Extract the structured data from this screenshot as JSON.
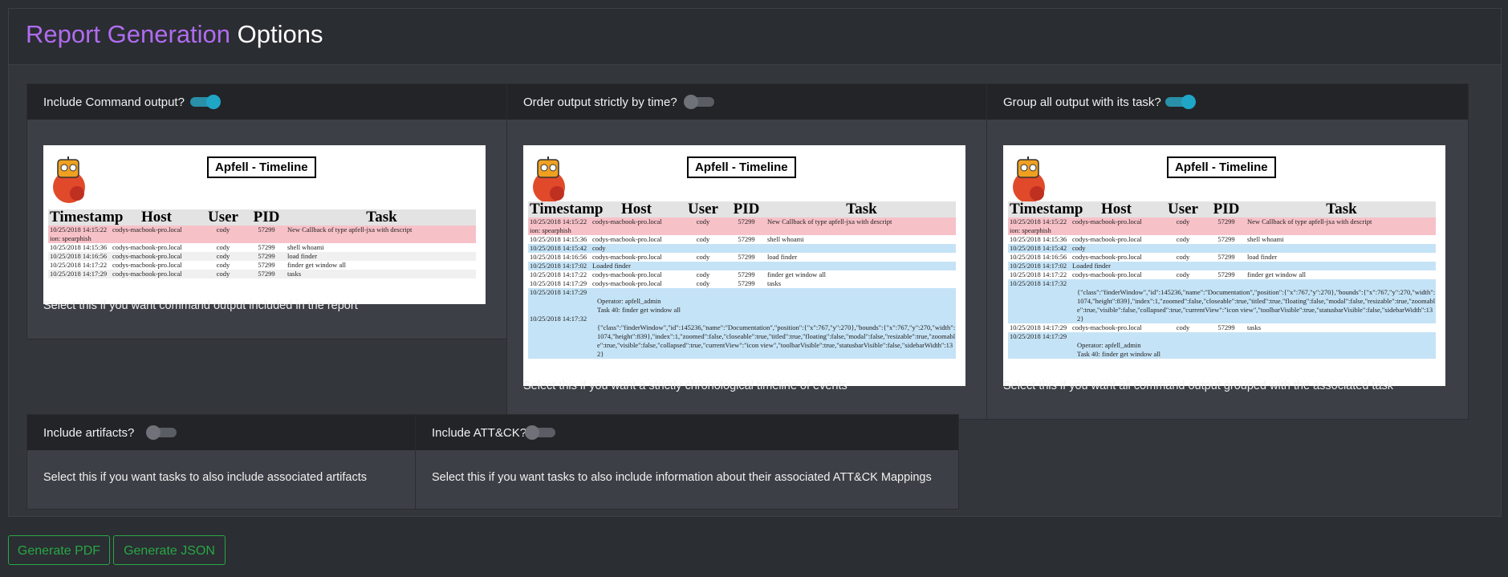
{
  "title": {
    "accent": "Report Generation",
    "rest": "Options"
  },
  "options": [
    {
      "label": "Include Command output?",
      "enabled": true,
      "description": "Select this if you want command output included in the report"
    },
    {
      "label": "Order output strictly by time?",
      "enabled": false,
      "description": "Select this if you want a strictly chronological timeline of events"
    },
    {
      "label": "Group all output with its task?",
      "enabled": true,
      "description": "Select this if you want all command output grouped with the associated task"
    },
    {
      "label": "Include artifacts?",
      "enabled": false,
      "description": "Select this if you want tasks to also include associated artifacts"
    },
    {
      "label": "Include ATT&CK?",
      "enabled": false,
      "description": "Select this if you want tasks to also include information about their associated ATT&CK Mappings"
    }
  ],
  "preview": {
    "title": "Apfell - Timeline",
    "headers": [
      "Timestamp",
      "Host",
      "User",
      "PID",
      "Task"
    ],
    "cmd_rows": [
      {
        "type": "red",
        "c": [
          "10/25/2018 14:15:22",
          "codys-macbook-pro.local",
          "cody",
          "57299",
          "New Callback of type apfell-jxa with descript"
        ],
        "extra": "ion: spearphish"
      },
      {
        "type": "plain",
        "c": [
          "10/25/2018 14:15:36",
          "codys-macbook-pro.local",
          "cody",
          "57299",
          "shell whoami"
        ]
      },
      {
        "type": "grey",
        "c": [
          "10/25/2018 14:16:56",
          "codys-macbook-pro.local",
          "cody",
          "57299",
          "load finder"
        ]
      },
      {
        "type": "plain",
        "c": [
          "10/25/2018 14:17:22",
          "codys-macbook-pro.local",
          "cody",
          "57299",
          "finder get window all"
        ]
      },
      {
        "type": "grey",
        "c": [
          "10/25/2018 14:17:29",
          "codys-macbook-pro.local",
          "cody",
          "57299",
          "tasks"
        ]
      }
    ],
    "time_rows": [
      {
        "type": "red",
        "c": [
          "10/25/2018 14:15:22",
          "codys-macbook-pro.local",
          "cody",
          "57299",
          "New Callback of type apfell-jxa with descript"
        ],
        "extra": "ion: spearphish"
      },
      {
        "type": "plain",
        "c": [
          "10/25/2018 14:15:36",
          "codys-macbook-pro.local",
          "cody",
          "57299",
          "shell whoami"
        ]
      },
      {
        "type": "blue",
        "c": [
          "10/25/2018 14:15:42",
          "cody",
          "",
          "",
          ""
        ]
      },
      {
        "type": "plain",
        "c": [
          "10/25/2018 14:16:56",
          "codys-macbook-pro.local",
          "cody",
          "57299",
          "load finder"
        ]
      },
      {
        "type": "blue",
        "c": [
          "10/25/2018 14:17:02",
          "Loaded finder",
          "",
          "",
          ""
        ]
      },
      {
        "type": "plain",
        "c": [
          "10/25/2018 14:17:22",
          "codys-macbook-pro.local",
          "cody",
          "57299",
          "finder get window all"
        ]
      },
      {
        "type": "plain",
        "c": [
          "10/25/2018 14:17:29",
          "codys-macbook-pro.local",
          "cody",
          "57299",
          "tasks"
        ]
      },
      {
        "type": "blue",
        "c": [
          "10/25/2018 14:17:29",
          "",
          "",
          "",
          ""
        ],
        "long": "Operator: apfell_admin\nTask 40: finder get window all"
      },
      {
        "type": "blue",
        "c": [
          "10/25/2018 14:17:32",
          "",
          "",
          "",
          ""
        ],
        "long": "{\"class\":\"finderWindow\",\"id\":145236,\"name\":\"Documentation\",\"position\":{\"x\":767,\"y\":270},\"bounds\":{\"x\":767,\"y\":270,\"width\":1074,\"height\":839},\"index\":1,\"zoomed\":false,\"closeable\":true,\"titled\":true,\"floating\":false,\"modal\":false,\"resizable\":true,\"zoomable\":true,\"visible\":false,\"collapsed\":true,\"currentView\":\"icon view\",\"toolbarVisible\":true,\"statusbarVisible\":false,\"sidebarWidth\":132}"
      }
    ],
    "group_rows": [
      {
        "type": "red",
        "c": [
          "10/25/2018 14:15:22",
          "codys-macbook-pro.local",
          "cody",
          "57299",
          "New Callback of type apfell-jxa with descript"
        ],
        "extra": "ion: spearphish"
      },
      {
        "type": "plain",
        "c": [
          "10/25/2018 14:15:36",
          "codys-macbook-pro.local",
          "cody",
          "57299",
          "shell whoami"
        ]
      },
      {
        "type": "blue",
        "c": [
          "10/25/2018 14:15:42",
          "cody",
          "",
          "",
          ""
        ]
      },
      {
        "type": "plain",
        "c": [
          "10/25/2018 14:16:56",
          "codys-macbook-pro.local",
          "cody",
          "57299",
          "load finder"
        ]
      },
      {
        "type": "blue",
        "c": [
          "10/25/2018 14:17:02",
          "Loaded finder",
          "",
          "",
          ""
        ]
      },
      {
        "type": "plain",
        "c": [
          "10/25/2018 14:17:22",
          "codys-macbook-pro.local",
          "cody",
          "57299",
          "finder get window all"
        ]
      },
      {
        "type": "blue",
        "c": [
          "10/25/2018 14:17:32",
          "",
          "",
          "",
          ""
        ],
        "long": "{\"class\":\"finderWindow\",\"id\":145236,\"name\":\"Documentation\",\"position\":{\"x\":767,\"y\":270},\"bounds\":{\"x\":767,\"y\":270,\"width\":1074,\"height\":839},\"index\":1,\"zoomed\":false,\"closeable\":true,\"titled\":true,\"floating\":false,\"modal\":false,\"resizable\":true,\"zoomable\":true,\"visible\":false,\"collapsed\":true,\"currentView\":\"icon view\",\"toolbarVisible\":true,\"statusbarVisible\":false,\"sidebarWidth\":132}"
      },
      {
        "type": "plain",
        "c": [
          "10/25/2018 14:17:29",
          "codys-macbook-pro.local",
          "cody",
          "57299",
          "tasks"
        ]
      },
      {
        "type": "blue",
        "c": [
          "10/25/2018 14:17:29",
          "",
          "",
          "",
          ""
        ],
        "long": "Operator: apfell_admin\nTask 40: finder get window all"
      }
    ]
  },
  "buttons": {
    "pdf": "Generate PDF",
    "json": "Generate JSON"
  },
  "colors": {
    "accent": "#b06cf0",
    "toggle_on": "#1fa6c6",
    "button": "#28a745"
  }
}
